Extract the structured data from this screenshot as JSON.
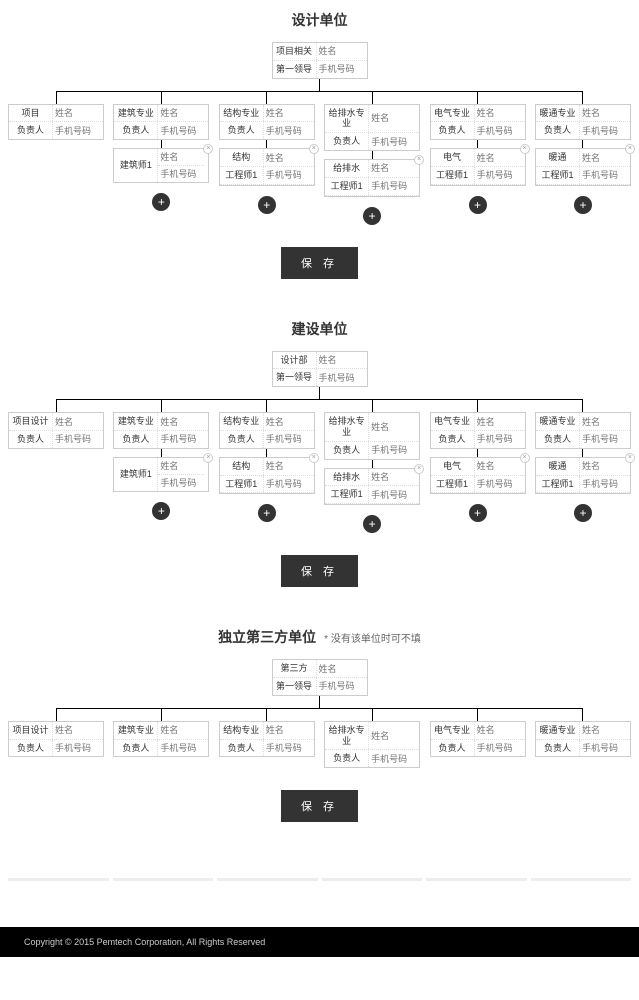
{
  "common": {
    "name_ph": "姓名",
    "phone_ph": "手机号码",
    "save": "保 存",
    "add": "+",
    "close": "×"
  },
  "footer": "Copyright ©  2015 Pemtech Corporation, All Rights Reserved",
  "sections": [
    {
      "title": "设计单位",
      "subtitle": "",
      "root_l1": "项目相关",
      "root_l2": "第一领导",
      "cols": [
        {
          "l1": "项目",
          "l2": "负责人",
          "sub_l1": "",
          "sub_l2": "",
          "has_sub": false,
          "has_add": false
        },
        {
          "l1": "建筑专业",
          "l2": "负责人",
          "sub_l1": "建筑师1",
          "sub_l2": "",
          "has_sub": true,
          "has_add": true
        },
        {
          "l1": "结构专业",
          "l2": "负责人",
          "sub_l1": "结构",
          "sub_l2": "工程师1",
          "has_sub": true,
          "has_add": true
        },
        {
          "l1": "给排水专业",
          "l2": "负责人",
          "sub_l1": "给排水",
          "sub_l2": "工程师1",
          "has_sub": true,
          "has_add": true
        },
        {
          "l1": "电气专业",
          "l2": "负责人",
          "sub_l1": "电气",
          "sub_l2": "工程师1",
          "has_sub": true,
          "has_add": true
        },
        {
          "l1": "暖通专业",
          "l2": "负责人",
          "sub_l1": "暖通",
          "sub_l2": "工程师1",
          "has_sub": true,
          "has_add": true
        }
      ]
    },
    {
      "title": "建设单位",
      "subtitle": "",
      "root_l1": "设计部",
      "root_l2": "第一领导",
      "cols": [
        {
          "l1": "项目设计",
          "l2": "负责人",
          "sub_l1": "",
          "sub_l2": "",
          "has_sub": false,
          "has_add": false
        },
        {
          "l1": "建筑专业",
          "l2": "负责人",
          "sub_l1": "建筑师1",
          "sub_l2": "",
          "has_sub": true,
          "has_add": true
        },
        {
          "l1": "结构专业",
          "l2": "负责人",
          "sub_l1": "结构",
          "sub_l2": "工程师1",
          "has_sub": true,
          "has_add": true
        },
        {
          "l1": "给排水专业",
          "l2": "负责人",
          "sub_l1": "给排水",
          "sub_l2": "工程师1",
          "has_sub": true,
          "has_add": true
        },
        {
          "l1": "电气专业",
          "l2": "负责人",
          "sub_l1": "电气",
          "sub_l2": "工程师1",
          "has_sub": true,
          "has_add": true
        },
        {
          "l1": "暖通专业",
          "l2": "负责人",
          "sub_l1": "暖通",
          "sub_l2": "工程师1",
          "has_sub": true,
          "has_add": true
        }
      ]
    },
    {
      "title": "独立第三方单位",
      "subtitle": "* 没有该单位时可不填",
      "root_l1": "第三方",
      "root_l2": "第一领导",
      "cols": [
        {
          "l1": "项目设计",
          "l2": "负责人",
          "has_sub": false,
          "has_add": false
        },
        {
          "l1": "建筑专业",
          "l2": "负责人",
          "has_sub": false,
          "has_add": false
        },
        {
          "l1": "结构专业",
          "l2": "负责人",
          "has_sub": false,
          "has_add": false
        },
        {
          "l1": "给排水专业",
          "l2": "负责人",
          "has_sub": false,
          "has_add": false
        },
        {
          "l1": "电气专业",
          "l2": "负责人",
          "has_sub": false,
          "has_add": false
        },
        {
          "l1": "暖通专业",
          "l2": "负责人",
          "has_sub": false,
          "has_add": false
        }
      ]
    }
  ]
}
